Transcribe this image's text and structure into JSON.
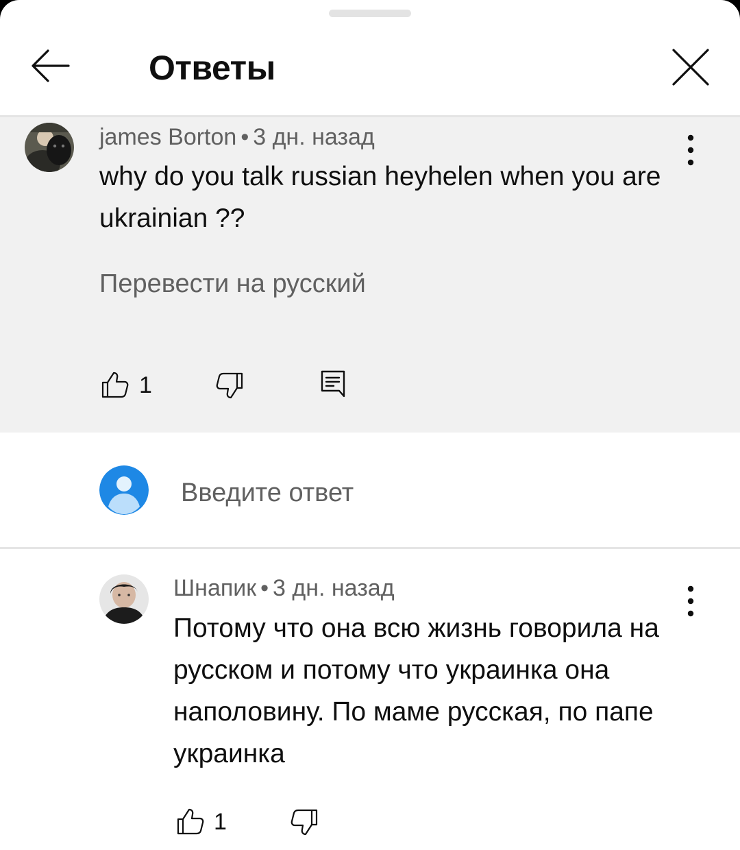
{
  "header": {
    "title": "Ответы"
  },
  "parent_comment": {
    "author": "james Borton",
    "age": "3 дн. назад",
    "text": "why do you talk russian heyhelen when you are ukrainian ??",
    "translate_label": "Перевести на русский",
    "like_count": "1"
  },
  "reply_box": {
    "placeholder": "Введите ответ"
  },
  "replies": [
    {
      "author": "Шнапик",
      "age": "3 дн. назад",
      "text": "Потому что она всю жизнь говорила на русском и потому что украинка она наполовину. По маме русская, по папе украинка",
      "like_count": "1"
    }
  ],
  "separator": "•",
  "icons": {
    "back": "arrow-left-icon",
    "close": "close-icon",
    "more": "more-vert-icon",
    "like": "thumb-up-icon",
    "dislike": "thumb-down-icon",
    "reply": "comment-icon"
  },
  "colors": {
    "sheet_bg": "#ffffff",
    "highlight_bg": "#f1f1f1",
    "secondary_text": "#606060",
    "avatar_blue": "#1e88e5"
  }
}
